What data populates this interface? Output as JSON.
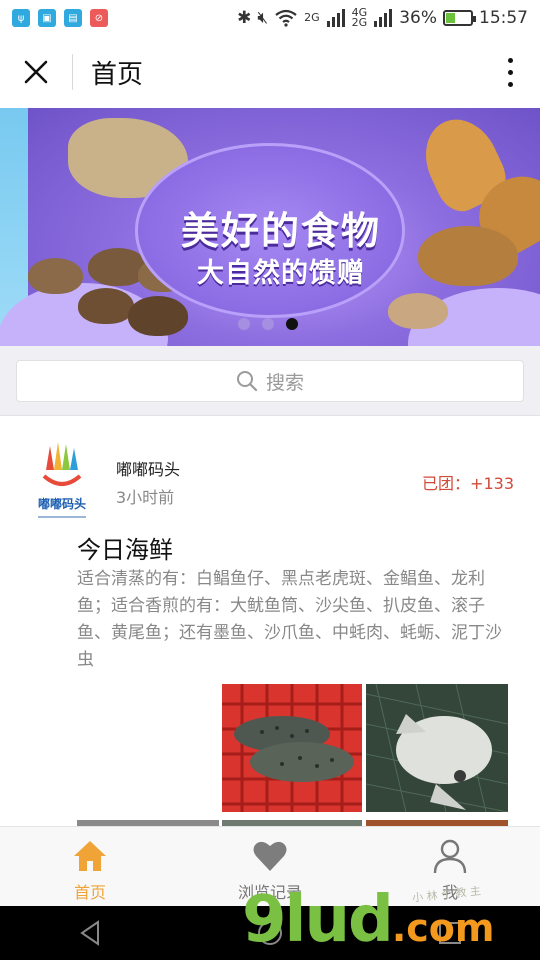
{
  "status_bar": {
    "battery": "36%",
    "battery_level": 0.36,
    "time": "15:57",
    "signal_1": "2G",
    "signal_2_top": "4G",
    "signal_2_bottom": "2G",
    "icons": [
      "usb-icon",
      "image-icon",
      "storage-icon",
      "blocked-icon",
      "bluetooth-icon",
      "mute-icon",
      "wifi-icon",
      "signal-icon",
      "battery-icon"
    ]
  },
  "header": {
    "title": "首页",
    "close_icon": "close-icon",
    "more_icon": "more-vertical-icon"
  },
  "banner": {
    "headline": "美好的食物",
    "subline": "大自然的馈赠",
    "slide_count": 3,
    "active_slide": 3,
    "colors": {
      "accent": "#8d6ee0"
    }
  },
  "search": {
    "placeholder": "搜索",
    "icon": "search-icon"
  },
  "post": {
    "author": "嘟嘟码头",
    "logo_text": "嘟嘟码头",
    "time": "3小时前",
    "joined_label": "已团：",
    "joined_count": "+133",
    "title": "今日海鲜",
    "description": "适合清蒸的有：白鲳鱼仔、黑点老虎斑、金鲳鱼、龙利鱼；适合香煎的有：大鱿鱼筒、沙尖鱼、扒皮鱼、滚子鱼、黄尾鱼；还有墨鱼、沙爪鱼、中蚝肉、蚝蛎、泥丁沙虫",
    "images": [
      "spotted-grouper-photo",
      "pomfret-photo"
    ]
  },
  "tabbar": {
    "items": [
      {
        "label": "首页",
        "icon": "home-icon",
        "active": true
      },
      {
        "label": "浏览记录",
        "icon": "heart-icon",
        "active": false
      },
      {
        "label": "我",
        "icon": "profile-icon",
        "active": false
      }
    ],
    "active_color": "#f0a437"
  },
  "navbar": {
    "icons": [
      "back-icon",
      "home-circle-icon",
      "recents-icon"
    ]
  },
  "watermark": {
    "main": "9lud",
    "domain": ".com",
    "sub": "小 林 个 教 主"
  }
}
